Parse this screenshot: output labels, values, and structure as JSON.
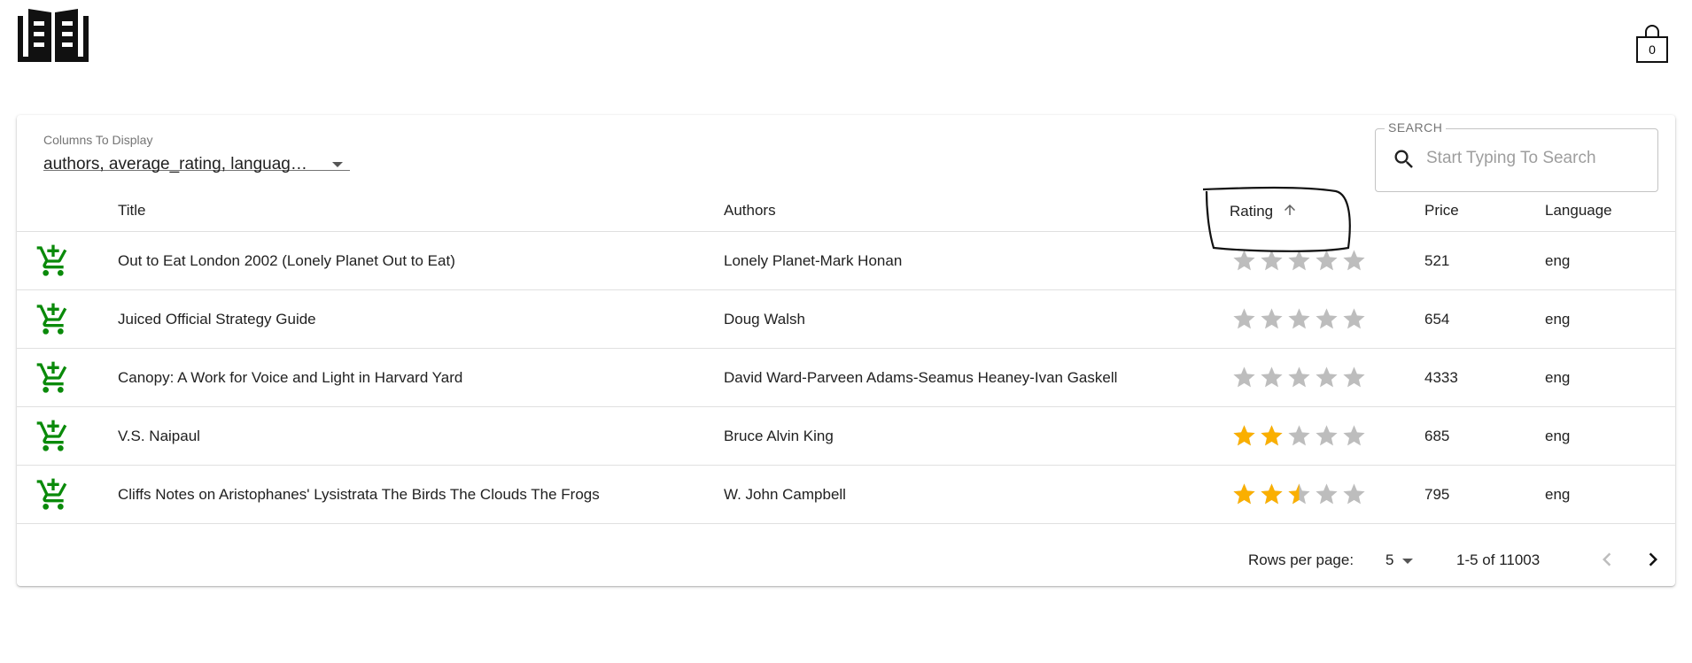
{
  "header": {
    "logo_icon": "book-logo-icon",
    "cart_icon": "shopping-bag-icon",
    "cart_count": "0"
  },
  "columns_select": {
    "label": "Columns To Display",
    "value": "authors, average_rating, language_code, price, title"
  },
  "search": {
    "legend": "SEARCH",
    "placeholder": "Start Typing To Search",
    "icon": "search-icon"
  },
  "table": {
    "headers": {
      "title": "Title",
      "authors": "Authors",
      "rating": "Rating",
      "price": "Price",
      "language": "Language"
    },
    "sort": {
      "column": "rating",
      "direction": "ascending",
      "icon": "arrow-up-icon"
    },
    "rows": [
      {
        "title": "Out to Eat London 2002 (Lonely Planet Out to Eat)",
        "authors": "Lonely Planet-Mark Honan",
        "rating": 0,
        "price": "521",
        "language": "eng"
      },
      {
        "title": "Juiced Official Strategy Guide",
        "authors": "Doug Walsh",
        "rating": 0,
        "price": "654",
        "language": "eng"
      },
      {
        "title": "Canopy: A Work for Voice and Light in Harvard Yard",
        "authors": "David Ward-Parveen Adams-Seamus Heaney-Ivan Gaskell",
        "rating": 0,
        "price": "4333",
        "language": "eng"
      },
      {
        "title": "V.S. Naipaul",
        "authors": "Bruce Alvin King",
        "rating": 2,
        "price": "685",
        "language": "eng"
      },
      {
        "title": "Cliffs Notes on Aristophanes' Lysistrata The Birds The Clouds The Frogs",
        "authors": "W. John Campbell",
        "rating": 2.5,
        "price": "795",
        "language": "eng"
      }
    ],
    "max_rating": 5
  },
  "pagination": {
    "rows_per_page_label": "Rows per page:",
    "rows_per_page": "5",
    "range": "1-5 of 11003",
    "prev_icon": "chevron-left-icon",
    "next_icon": "chevron-right-icon"
  },
  "colors": {
    "cart_green": "#0a8a0a",
    "star_filled": "#faaf00",
    "star_empty": "#bdbdbd"
  }
}
